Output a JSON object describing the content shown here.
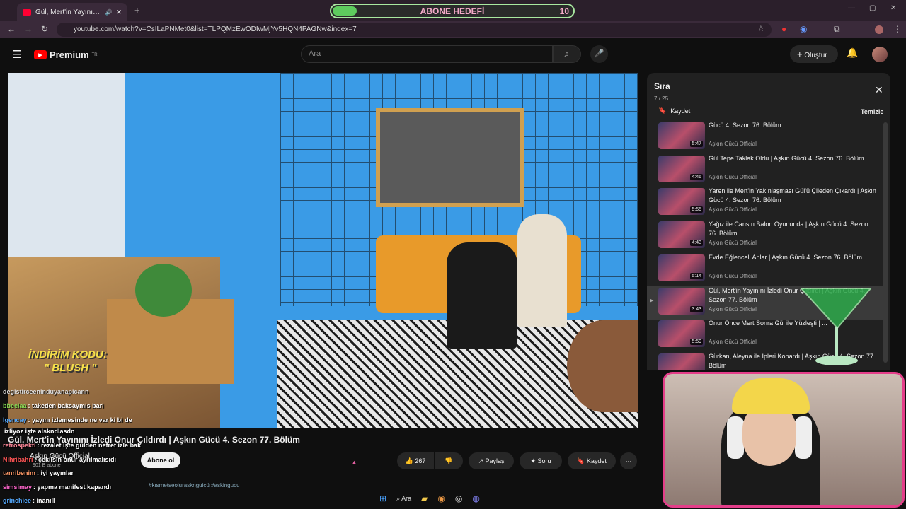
{
  "browser": {
    "tab_title": "Gül, Mert'in Yayınını İzledi O",
    "url": "youtube.com/watch?v=CsILaPNMet0&list=TLPQMzEwODIwMjYv5HQN4PAGNw&index=7"
  },
  "goal_widget": {
    "label": "ABONE HEDEFİ",
    "value": "10",
    "progress": 0.1
  },
  "youtube": {
    "logo": "Premium",
    "logo_region": "TR",
    "search_placeholder": "Ara",
    "create_label": "Oluştur"
  },
  "video": {
    "promo_line1": "İNDİRİM KODU:",
    "promo_line2": "\" BLUSH \"",
    "title": "Gül, Mert'in Yayınını İzledi Onur Çıldırdı | Aşkın Gücü 4. Sezon 77. Bölüm",
    "channel": "Aşkın Gücü Official",
    "subscribers": "901 B abone",
    "subscribe_label": "Abone ol",
    "like_count": "267",
    "share_label": "Paylaş",
    "ask_label": "Soru",
    "save_label": "Kaydet",
    "description_snippet": "#kısmetseolurasknguicü #askingucu"
  },
  "playlist": {
    "title": "Sıra",
    "count": "7 / 25",
    "save_label": "Kaydet",
    "clear_label": "Temizle",
    "items": [
      {
        "title": "Gücü 4. Sezon 76. Bölüm",
        "channel": "Aşkın Gücü Official",
        "duration": "5:47",
        "active": false
      },
      {
        "title": "Gül Tepe Taklak Oldu | Aşkın Gücü 4. Sezon 76. Bölüm",
        "channel": "Aşkın Gücü Official",
        "duration": "4:46",
        "active": false
      },
      {
        "title": "Yaren ile Mert'in Yakınlaşması Gül'ü Çileden Çıkardı | Aşkın Gücü 4. Sezon 76. Bölüm",
        "channel": "Aşkın Gücü Official",
        "duration": "5:55",
        "active": false
      },
      {
        "title": "Yağız ile Cansın Balon Oyununda | Aşkın Gücü 4. Sezon 76. Bölüm",
        "channel": "Aşkın Gücü Official",
        "duration": "4:43",
        "active": false
      },
      {
        "title": "Evde Eğlenceli Anlar | Aşkın Gücü 4. Sezon 76. Bölüm",
        "channel": "Aşkın Gücü Official",
        "duration": "5:14",
        "active": false
      },
      {
        "title": "Gül, Mert'in Yayınını İzledi Onur Çıldırdı | Aşkın Gücü 4. Sezon 77. Bölüm",
        "channel": "Aşkın Gücü Official",
        "duration": "3:43",
        "active": true
      },
      {
        "title": "Onur Önce Mert Sonra Gül ile Yüzleşti | ...",
        "channel": "Aşkın Gücü Official",
        "duration": "5:59",
        "active": false
      },
      {
        "title": "Gürkan, Aleyna ile İpleri Kopardı | Aşkın Gücü 4. Sezon 77. Bölüm",
        "channel": "Aşkın Gücü Official",
        "duration": "6:02",
        "active": false
      }
    ]
  },
  "chat": [
    {
      "user": "degistirceeninduyanapicann",
      "msg": "",
      "color": "#dddddd"
    },
    {
      "user": "bbeelaa",
      "msg": ": takeden baksaymis bari",
      "color": "#88dd55"
    },
    {
      "user": "lgencay",
      "msg": ": yayını izlemesinde ne var ki bi de",
      "color": "#55aaff"
    },
    {
      "user": "",
      "msg": "izliyoz işte alskndlasdn",
      "color": "#ffffff"
    },
    {
      "user": "retrospekti",
      "msg": ": rezalet işte gülden nefret izle bak",
      "color": "#ff8899"
    },
    {
      "user": "Nihribahri",
      "msg": ": çekilsin onur ayrılmalısıdı",
      "color": "#ff5555"
    },
    {
      "user": "tanribenim",
      "msg": ": iyi yayınlar",
      "color": "#ff9966"
    },
    {
      "user": "simsimay",
      "msg": ": yapma manifest kapandı",
      "color": "#ff66cc"
    },
    {
      "user": "grinchiee",
      "msg": ": inanıll",
      "color": "#55aaff"
    }
  ],
  "taskbar": {
    "search_label": "Ara"
  },
  "colors": {
    "accent": "#ff0000",
    "cam_border": "#e43e8a",
    "goal_border": "#a9e8a0"
  }
}
